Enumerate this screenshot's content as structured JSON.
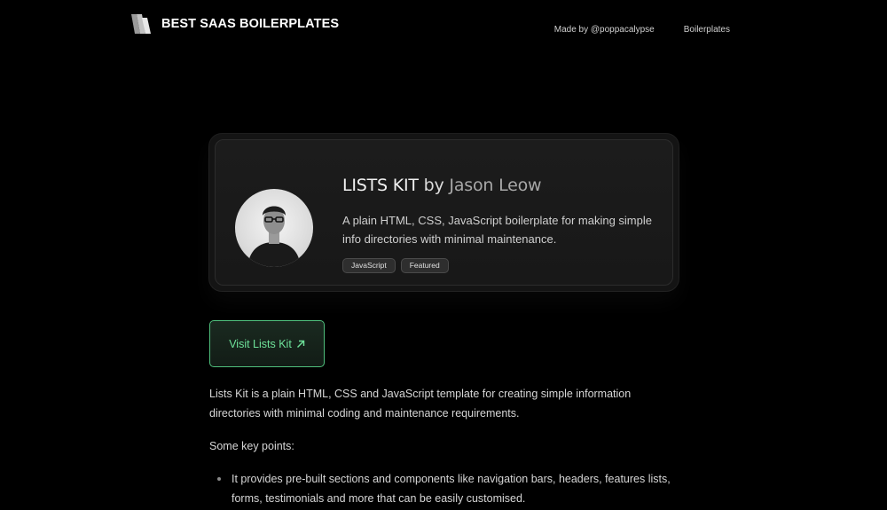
{
  "header": {
    "brand_name": "BEST SAAS BOILERPLATES",
    "logo_icon": "stacked-bars-logo",
    "nav": [
      {
        "label": "Made by @poppacalypse"
      },
      {
        "label": "Boilerplates"
      }
    ]
  },
  "card": {
    "title_product": "LISTS KIT",
    "title_by": "by",
    "title_author": "Jason Leow",
    "description": "A plain HTML, CSS, JavaScript boilerplate for making simple info directories with minimal maintenance.",
    "tags": [
      "JavaScript",
      "Featured"
    ]
  },
  "visit_button": {
    "label": "Visit Lists Kit",
    "icon": "arrow-up-right-icon",
    "color": "#6ee29a"
  },
  "content": {
    "paragraph_1": "Lists Kit is a plain HTML, CSS and JavaScript template for creating simple information directories with minimal coding and maintenance requirements.",
    "paragraph_2": "Some key points:",
    "bullets": [
      "It provides pre-built sections and components like navigation bars, headers, features lists, forms, testimonials and more that can be easily customised."
    ]
  },
  "colors": {
    "background": "#000000",
    "accent": "#4fbf7c"
  }
}
